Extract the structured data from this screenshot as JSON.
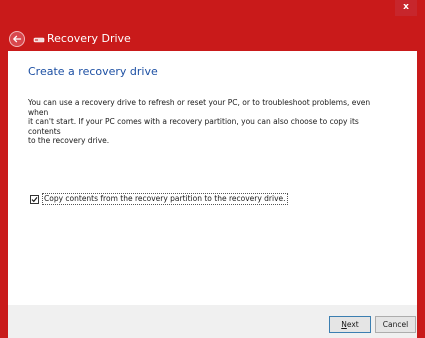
{
  "window": {
    "title": "Recovery Drive",
    "close_glyph": "x",
    "accent_color": "#c91a1a"
  },
  "icons": {
    "back": "back-arrow-icon",
    "drive": "drive-icon",
    "close": "close-icon"
  },
  "main": {
    "heading": "Create a recovery drive",
    "paragraph_lines": [
      "You can use a recovery drive to refresh or reset your PC, or to troubleshoot problems, even when",
      "it can't start. If your PC comes with a recovery partition, you can also choose to copy its contents",
      "to the recovery drive."
    ],
    "checkbox_label": "Copy contents from the recovery partition to the recovery drive.",
    "checkbox_checked": true
  },
  "footer": {
    "next_underlined": "N",
    "next_rest": "ext",
    "cancel_label": "Cancel"
  }
}
